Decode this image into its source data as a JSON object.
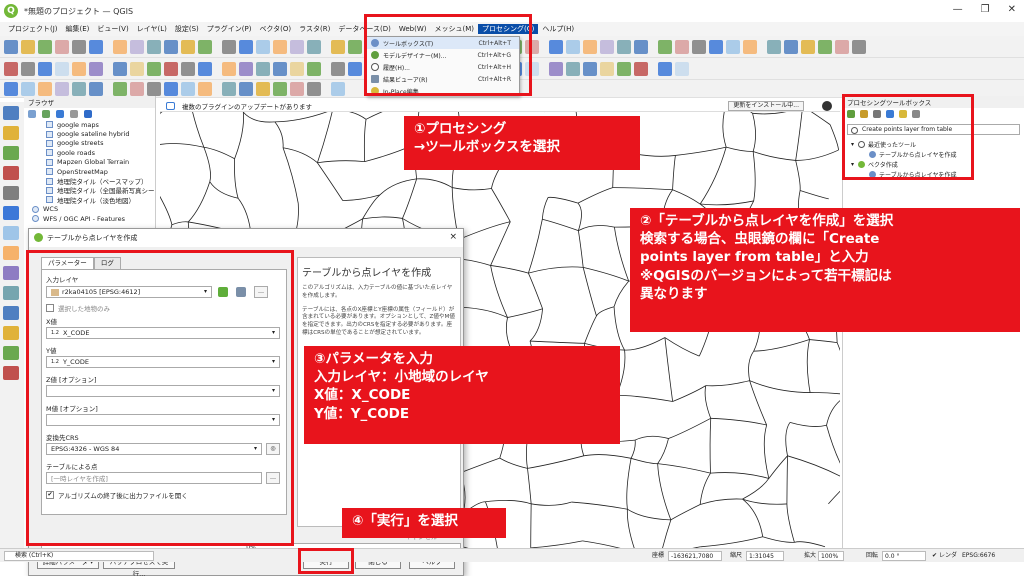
{
  "window": {
    "title": "*無題のプロジェクト — QGIS",
    "min": "—",
    "restore": "❐",
    "close": "✕"
  },
  "menu": [
    "プロジェクト(J)",
    "編集(E)",
    "ビュー(V)",
    "レイヤ(L)",
    "設定(S)",
    "プラグイン(P)",
    "ベクタ(O)",
    "ラスタ(R)",
    "データベース(D)",
    "Web(W)",
    "メッシュ(M)",
    "プロセシング(C)",
    "ヘルプ(H)"
  ],
  "processing_menu": [
    {
      "label": "ツールボックス(T)",
      "shortcut": "Ctrl+Alt+T"
    },
    {
      "label": "モデルデザイナー(M)...",
      "shortcut": "Ctrl+Alt+G"
    },
    {
      "label": "履歴(H)...",
      "shortcut": "Ctrl+Alt+H"
    },
    {
      "label": "結果ビューア(R)",
      "shortcut": "Ctrl+Alt+R"
    },
    {
      "label": "In-Place編集",
      "shortcut": ""
    }
  ],
  "browser": {
    "title": "ブラウザ",
    "items": [
      "google maps",
      "google sateline hybrid",
      "google streets",
      "goole roads",
      "Mapzen Global Terrain",
      "OpenStreetMap",
      "地理院タイル（ベースマップ）",
      "地理院タイル（全国最新写真シー",
      "地理院タイル（淡色地図）",
      "WCS",
      "WFS / OGC API - Features"
    ]
  },
  "plugin_bar": {
    "text": "複数のプラグインのアップデートがあります",
    "update_button": "更新をインストール中..."
  },
  "toolbox": {
    "title": "プロセシングツールボックス",
    "search": "Create points layer from table",
    "recent": "最近使ったツール",
    "recent_tool": "テーブルから点レイヤを作成",
    "vector": "ベクタ作成",
    "vector_tool": "テーブルから点レイヤを作成"
  },
  "dialog": {
    "title": "テーブルから点レイヤを作成",
    "tab_params": "パラメーター",
    "tab_log": "ログ",
    "input_layer_label": "入力レイヤ",
    "input_layer_value": "r2ka04105 [EPSG:4612]",
    "selected_only": "選択した地物のみ",
    "x_label": "X値",
    "x_value": "X_CODE",
    "y_label": "Y値",
    "y_value": "Y_CODE",
    "z_label": "Z値 [オプション]",
    "m_label": "M値 [オプション]",
    "crs_label": "変換先CRS",
    "crs_value": "EPSG:4326 - WGS 84",
    "out_label": "テーブルによる点",
    "out_placeholder": "[一時レイヤを作成]",
    "open_output": "アルゴリズムの終了後に出力ファイルを開く",
    "help_title": "テーブルから点レイヤを作成",
    "help_p1": "このアルゴリズムは、入力テーブルの値に基づいた点レイヤを作成します。",
    "help_p2": "テーブルには、各点のX座標とY座標の属性（フィールド）が含まれている必要があります。オプションとして、Z値やM値を指定できます。出力のCRSを指定する必要があります。座標はCRSの単位であることが想定されています。",
    "progress": "0%",
    "cancel": "キャンセル",
    "advanced": "詳細パラメータ ▾",
    "batch": "バッチプロセスで実行...",
    "run": "実行",
    "close": "閉じる",
    "help": "ヘルプ"
  },
  "callouts": {
    "c1": "①プロセシング\n→ツールボックスを選択",
    "c2": "②「テーブルから点レイヤを作成」を選択\n検索する場合、虫眼鏡の欄に「Create\npoints layer from table」と入力\n※QGISのバージョンによって若干標記は\n異なります",
    "c3": "③パラメータを入力\n入力レイヤ：小地域のレイヤ\nX値：X_CODE\nY値：Y_CODE",
    "c4": "④「実行」を選択"
  },
  "status": {
    "search_placeholder": "検索 (Ctrl+K)",
    "coord_label": "座標",
    "coord": "-163621,7080",
    "scale_label": "縮尺",
    "scale": "1:31045",
    "mag_label": "拡大",
    "mag": "100%",
    "rot_label": "回転",
    "rot": "0.0 °",
    "render": "レンダ",
    "crs": "EPSG:6676"
  },
  "colors": {
    "accent": "#e8141c",
    "menu_active": "#0a4ea8",
    "qgis_green": "#73b838"
  }
}
